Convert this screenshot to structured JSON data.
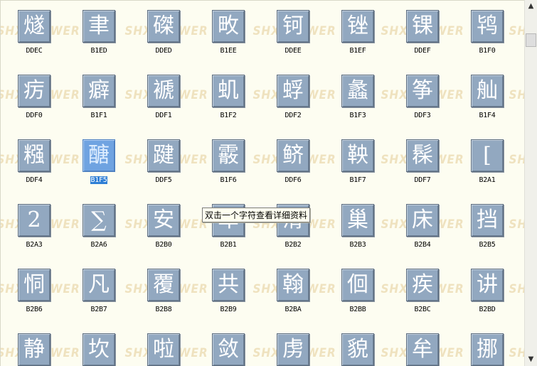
{
  "watermark": "SHX VIEWER",
  "rows": [
    [
      {
        "ch": "燧",
        "code": "DDEC"
      },
      {
        "ch": "聿",
        "code": "B1ED"
      },
      {
        "ch": "磔",
        "code": "DDED"
      },
      {
        "ch": "畋",
        "code": "B1EE"
      },
      {
        "ch": "钶",
        "code": "DDEE"
      },
      {
        "ch": "锉",
        "code": "B1EF"
      },
      {
        "ch": "锞",
        "code": "DDEF"
      },
      {
        "ch": "鸨",
        "code": "B1F0"
      }
    ],
    [
      {
        "ch": "疠",
        "code": "DDF0"
      },
      {
        "ch": "癖",
        "code": "B1F1"
      },
      {
        "ch": "褫",
        "code": "DDF1"
      },
      {
        "ch": "虮",
        "code": "B1F2"
      },
      {
        "ch": "蜉",
        "code": "DDF2"
      },
      {
        "ch": "蠡",
        "code": "B1F3"
      },
      {
        "ch": "筝",
        "code": "DDF3"
      },
      {
        "ch": "舢",
        "code": "B1F4"
      }
    ],
    [
      {
        "ch": "糨",
        "code": "DDF4"
      },
      {
        "ch": "醣",
        "code": "B1F5",
        "selected": true
      },
      {
        "ch": "踺",
        "code": "DDF5"
      },
      {
        "ch": "霰",
        "code": "B1F6"
      },
      {
        "ch": "鲚",
        "code": "DDF6"
      },
      {
        "ch": "鞅",
        "code": "B1F7"
      },
      {
        "ch": "髹",
        "code": "DDF7"
      },
      {
        "ch": "[",
        "code": "B2A1"
      }
    ],
    [
      {
        "ch": "2",
        "code": "B2A3"
      },
      {
        "ch": "∑",
        "code": "B2A6"
      },
      {
        "ch": "安",
        "code": "B2B0"
      },
      {
        "ch": "车",
        "code": "B2B1"
      },
      {
        "ch": "滑",
        "code": "B2B2"
      },
      {
        "ch": "巢",
        "code": "B2B3"
      },
      {
        "ch": "床",
        "code": "B2B4"
      },
      {
        "ch": "挡",
        "code": "B2B5"
      }
    ],
    [
      {
        "ch": "恫",
        "code": "B2B6"
      },
      {
        "ch": "凡",
        "code": "B2B7"
      },
      {
        "ch": "覆",
        "code": "B2B8"
      },
      {
        "ch": "共",
        "code": "B2B9"
      },
      {
        "ch": "翰",
        "code": "B2BA"
      },
      {
        "ch": "佪",
        "code": "B2BB"
      },
      {
        "ch": "疾",
        "code": "B2BC"
      },
      {
        "ch": "讲",
        "code": "B2BD"
      }
    ],
    [
      {
        "ch": "静",
        "code": ""
      },
      {
        "ch": "坎",
        "code": ""
      },
      {
        "ch": "啦",
        "code": ""
      },
      {
        "ch": "敛",
        "code": ""
      },
      {
        "ch": "虏",
        "code": ""
      },
      {
        "ch": "貌",
        "code": ""
      },
      {
        "ch": "牟",
        "code": ""
      },
      {
        "ch": "挪",
        "code": ""
      }
    ]
  ],
  "tooltip": "双击一个字符查看详细资料",
  "scrollbar": {
    "up_arrow": "▲",
    "down_arrow": "▼"
  }
}
